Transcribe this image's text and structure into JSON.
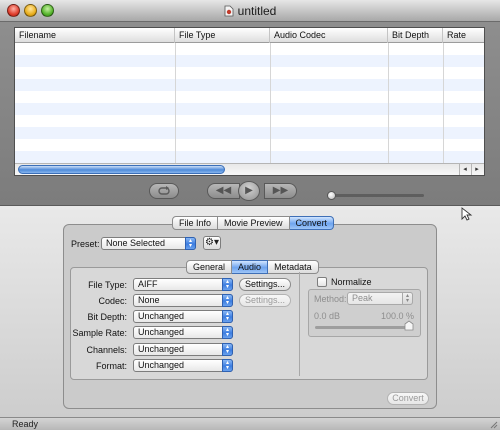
{
  "window": {
    "title": "untitled"
  },
  "table": {
    "columns": [
      "Filename",
      "File Type",
      "Audio Codec",
      "Bit Depth",
      "Rate"
    ],
    "rows": [],
    "scroll_arrows": {
      "left": "◂",
      "right": "▸"
    }
  },
  "transport": {
    "loop_icon": "loop-icon",
    "rewind_glyph": "◀◀",
    "play_glyph": "▶",
    "ff_glyph": "▶▶"
  },
  "main_tabs": [
    {
      "label": "File Info",
      "active": false
    },
    {
      "label": "Movie Preview",
      "active": false
    },
    {
      "label": "Convert",
      "active": true
    }
  ],
  "convert": {
    "preset_label": "Preset:",
    "preset_value": "None Selected",
    "gear_glyph": "⚙▾",
    "sub_tabs": [
      {
        "label": "General",
        "active": false
      },
      {
        "label": "Audio",
        "active": true
      },
      {
        "label": "Metadata",
        "active": false
      }
    ],
    "audio": {
      "file_type": {
        "label": "File Type:",
        "value": "AIFF"
      },
      "codec": {
        "label": "Codec:",
        "value": "None"
      },
      "bit_depth": {
        "label": "Bit Depth:",
        "value": "Unchanged"
      },
      "sample_rate": {
        "label": "Sample Rate:",
        "value": "Unchanged"
      },
      "channels": {
        "label": "Channels:",
        "value": "Unchanged"
      },
      "format": {
        "label": "Format:",
        "value": "Unchanged"
      },
      "settings_label": "Settings...",
      "normalize_label": "Normalize",
      "normalize_checked": false,
      "method_label": "Method:",
      "method_value": "Peak",
      "min_db": "0.0 dB",
      "max_pct": "100.0 %",
      "normalize_level": 1.0
    },
    "convert_button": "Convert"
  },
  "status": {
    "text": "Ready"
  },
  "colors": {
    "accent": "#3c7de0",
    "row_alt": "#edf3fe"
  }
}
